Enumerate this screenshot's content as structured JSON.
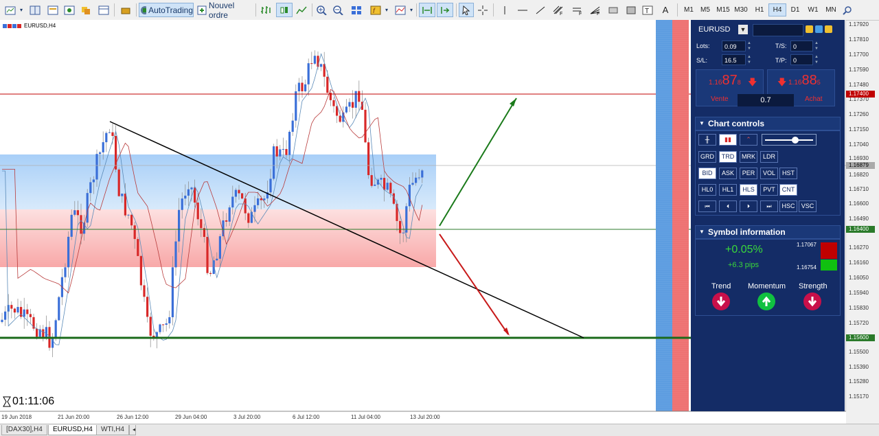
{
  "toolbar": {
    "autotrading_label": "AutoTrading",
    "new_order_label": "Nouvel ordre",
    "timeframes": [
      "M1",
      "M5",
      "M15",
      "M30",
      "H1",
      "H4",
      "D1",
      "W1",
      "MN"
    ],
    "active_timeframe": "H4"
  },
  "chart": {
    "symbol_label": "EURUSD,H4",
    "timer": "01:11:06",
    "price_labels": [
      "1.17920",
      "1.17810",
      "1.17700",
      "1.17590",
      "1.17480",
      "1.17370",
      "1.17260",
      "1.17150",
      "1.17040",
      "1.16930",
      "1.16820",
      "1.16710",
      "1.16600",
      "1.16490",
      "1.16270",
      "1.16160",
      "1.16050",
      "1.15940",
      "1.15830",
      "1.15720",
      "1.15500",
      "1.15390",
      "1.15280",
      "1.15170"
    ],
    "highlight_labels": {
      "red_line": "1.17400",
      "current_price": "1.16879",
      "green_line_upper": "1.16400",
      "green_line_lower": "1.15600"
    },
    "time_labels": [
      "19 Jun 2018",
      "21 Jun 20:00",
      "26 Jun 12:00",
      "29 Jun 04:00",
      "3 Jul 20:00",
      "6 Jul 12:00",
      "11 Jul 04:00",
      "13 Jul 20:00"
    ],
    "colors": {
      "bull": "#3a6fd8",
      "bear": "#d82828",
      "red_line": "#c00000",
      "green_line": "#2a7a2a",
      "trend": "#000000"
    }
  },
  "tabs": [
    "[DAX30],H4",
    "EURUSD,H4",
    "WTI,H4"
  ],
  "active_tab": "EURUSD,H4",
  "panel": {
    "symbol": "EURUSD",
    "lots_label": "Lots:",
    "lots_value": "0.09",
    "sl_label": "S/L:",
    "sl_value": "16.5",
    "ts_label": "T/S:",
    "ts_value": "0",
    "tp_label": "T/P:",
    "tp_value": "0",
    "sell": {
      "prefix": "1.16",
      "big": "87",
      "small": "8",
      "label": "Vente"
    },
    "buy": {
      "prefix": "1.16",
      "big": "88",
      "small": "5",
      "label": "Achat"
    },
    "spread": "0.7",
    "chart_controls_title": "Chart controls",
    "controls_row1": [
      "GRD",
      "TRD",
      "MRK",
      "LDR"
    ],
    "controls_row2": [
      "BID",
      "ASK",
      "PER",
      "VOL",
      "HST"
    ],
    "controls_row3": [
      "HL0",
      "HL1",
      "HLS",
      "PVT",
      "CNT"
    ],
    "controls_row4_extra": [
      "HSC",
      "VSC"
    ],
    "symbol_info_title": "Symbol information",
    "change_pct": "+0.05%",
    "change_pips": "+6.3 pips",
    "high": "1.17067",
    "low": "1.16754",
    "trend_label": "Trend",
    "momentum_label": "Momentum",
    "strength_label": "Strength"
  }
}
